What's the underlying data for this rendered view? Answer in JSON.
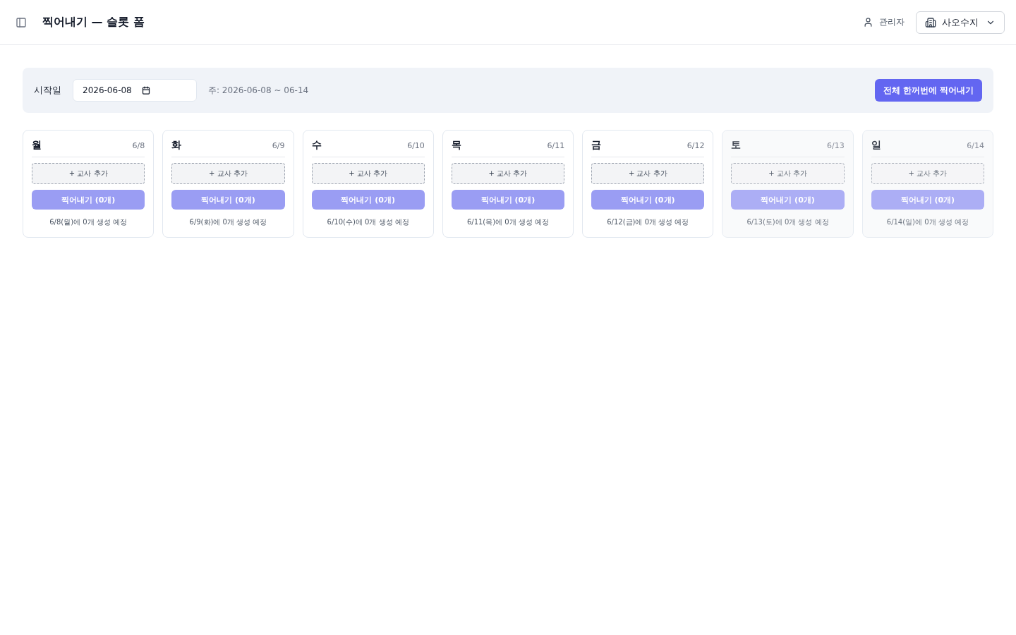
{
  "header": {
    "title": "찍어내기 — 슬롯 폼",
    "user": "관리자",
    "org_selector": "사오수지"
  },
  "toolbar": {
    "start_label": "시작일",
    "start_date": {
      "value": "2026-06-08"
    },
    "week_range": "주: 2026-06-08 ~ 06-14",
    "export_all_button": "전체 한꺼번에 찍어내기"
  },
  "days": [
    {
      "day": "월",
      "date": "6/8",
      "dimmed": false,
      "add_teacher": "+ 교사 추가",
      "export_button": {
        "label": "찍어내기 (0개)",
        "disabled": true
      },
      "note": "6/8(월)에 0개 생성 예정"
    },
    {
      "day": "화",
      "date": "6/9",
      "dimmed": false,
      "add_teacher": "+ 교사 추가",
      "export_button": {
        "label": "찍어내기 (0개)",
        "disabled": true
      },
      "note": "6/9(화)에 0개 생성 예정"
    },
    {
      "day": "수",
      "date": "6/10",
      "dimmed": false,
      "add_teacher": "+ 교사 추가",
      "export_button": {
        "label": "찍어내기 (0개)",
        "disabled": true
      },
      "note": "6/10(수)에 0개 생성 예정"
    },
    {
      "day": "목",
      "date": "6/11",
      "dimmed": false,
      "add_teacher": "+ 교사 추가",
      "export_button": {
        "label": "찍어내기 (0개)",
        "disabled": true
      },
      "note": "6/11(목)에 0개 생성 예정"
    },
    {
      "day": "금",
      "date": "6/12",
      "dimmed": false,
      "add_teacher": "+ 교사 추가",
      "export_button": {
        "label": "찍어내기 (0개)",
        "disabled": true
      },
      "note": "6/12(금)에 0개 생성 예정"
    },
    {
      "day": "토",
      "date": "6/13",
      "dimmed": true,
      "add_teacher": "+ 교사 추가",
      "export_button": {
        "label": "찍어내기 (0개)",
        "disabled": true
      },
      "note": "6/13(토)에 0개 생성 예정"
    },
    {
      "day": "일",
      "date": "6/14",
      "dimmed": true,
      "add_teacher": "+ 교사 추가",
      "export_button": {
        "label": "찍어내기 (0개)",
        "disabled": true
      },
      "note": "6/14(일)에 0개 생성 예정"
    }
  ]
}
